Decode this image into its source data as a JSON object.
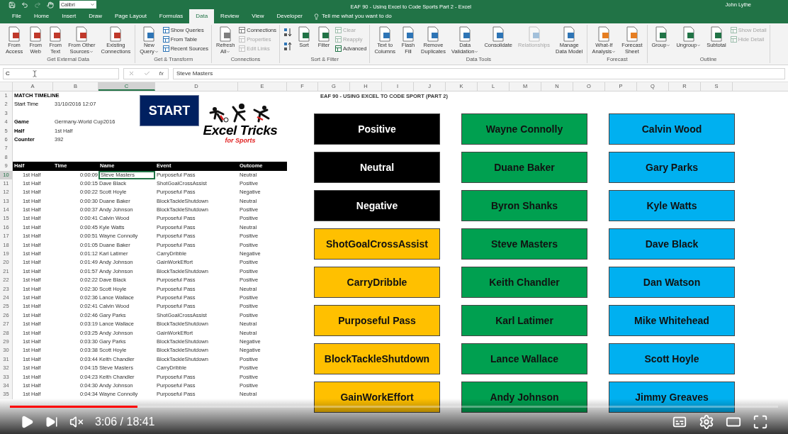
{
  "title_bar": {
    "font_box": "Calibri",
    "title": "EAF 90 - Using Excel to Code Sports Part 2 - Excel",
    "user": "John Lythe"
  },
  "tabs": [
    {
      "label": "File",
      "selected": false
    },
    {
      "label": "Home",
      "selected": false
    },
    {
      "label": "Insert",
      "selected": false
    },
    {
      "label": "Draw",
      "selected": false
    },
    {
      "label": "Page Layout",
      "selected": false
    },
    {
      "label": "Formulas",
      "selected": false
    },
    {
      "label": "Data",
      "selected": true
    },
    {
      "label": "Review",
      "selected": false
    },
    {
      "label": "View",
      "selected": false
    },
    {
      "label": "Developer",
      "selected": false
    }
  ],
  "tell_me": "Tell me what you want to do",
  "ribbon_groups": [
    {
      "label": "Get External Data",
      "items": [
        {
          "kind": "large",
          "lines": [
            "From",
            "Access"
          ],
          "dropdown": false,
          "disabled": false
        },
        {
          "kind": "large",
          "lines": [
            "From",
            "Web"
          ],
          "dropdown": false,
          "disabled": false
        },
        {
          "kind": "large",
          "lines": [
            "From",
            "Text"
          ],
          "dropdown": false,
          "disabled": false
        },
        {
          "kind": "large",
          "lines": [
            "From Other",
            "Sources"
          ],
          "dropdown": true,
          "disabled": false
        },
        {
          "kind": "large",
          "lines": [
            "Existing",
            "Connections"
          ],
          "dropdown": false,
          "disabled": false
        }
      ]
    },
    {
      "label": "Get & Transform",
      "items": [
        {
          "kind": "large",
          "lines": [
            "New",
            "Query"
          ],
          "dropdown": true,
          "disabled": false
        },
        {
          "kind": "small",
          "lines": [
            "Show Queries"
          ],
          "dropdown": false,
          "disabled": false
        },
        {
          "kind": "small",
          "lines": [
            "From Table"
          ],
          "dropdown": false,
          "disabled": false
        },
        {
          "kind": "small",
          "lines": [
            "Recent Sources"
          ],
          "dropdown": false,
          "disabled": false
        }
      ]
    },
    {
      "label": "Connections",
      "items": [
        {
          "kind": "large",
          "lines": [
            "Refresh",
            "All"
          ],
          "dropdown": true,
          "disabled": false
        },
        {
          "kind": "small",
          "lines": [
            "Connections"
          ],
          "dropdown": false,
          "disabled": false
        },
        {
          "kind": "small",
          "lines": [
            "Properties"
          ],
          "dropdown": false,
          "disabled": true
        },
        {
          "kind": "small",
          "lines": [
            "Edit Links"
          ],
          "dropdown": false,
          "disabled": true
        }
      ]
    },
    {
      "label": "Sort & Filter",
      "items": [
        {
          "kind": "sort_icons",
          "disabled": false
        },
        {
          "kind": "large",
          "lines": [
            "Sort"
          ],
          "dropdown": false,
          "disabled": false
        },
        {
          "kind": "large",
          "lines": [
            "Filter"
          ],
          "dropdown": false,
          "disabled": false
        },
        {
          "kind": "small",
          "lines": [
            "Clear"
          ],
          "dropdown": false,
          "disabled": true
        },
        {
          "kind": "small",
          "lines": [
            "Reapply"
          ],
          "dropdown": false,
          "disabled": true
        },
        {
          "kind": "small",
          "lines": [
            "Advanced"
          ],
          "dropdown": false,
          "disabled": false
        }
      ]
    },
    {
      "label": "Data Tools",
      "items": [
        {
          "kind": "large",
          "lines": [
            "Text to",
            "Columns"
          ],
          "dropdown": false,
          "disabled": false
        },
        {
          "kind": "large",
          "lines": [
            "Flash",
            "Fill"
          ],
          "dropdown": false,
          "disabled": false
        },
        {
          "kind": "large",
          "lines": [
            "Remove",
            "Duplicates"
          ],
          "dropdown": false,
          "disabled": false
        },
        {
          "kind": "large",
          "lines": [
            "Data",
            "Validation"
          ],
          "dropdown": true,
          "disabled": false
        },
        {
          "kind": "large",
          "lines": [
            "Consolidate"
          ],
          "dropdown": false,
          "disabled": false
        },
        {
          "kind": "large",
          "lines": [
            "Relationships"
          ],
          "dropdown": false,
          "disabled": true
        },
        {
          "kind": "large",
          "lines": [
            "Manage",
            "Data Model"
          ],
          "dropdown": false,
          "disabled": false
        }
      ]
    },
    {
      "label": "Forecast",
      "items": [
        {
          "kind": "large",
          "lines": [
            "What-If",
            "Analysis"
          ],
          "dropdown": true,
          "disabled": false
        },
        {
          "kind": "large",
          "lines": [
            "Forecast",
            "Sheet"
          ],
          "dropdown": false,
          "disabled": false
        }
      ]
    },
    {
      "label": "Outline",
      "items": [
        {
          "kind": "large",
          "lines": [
            "Group"
          ],
          "dropdown": true,
          "disabled": false
        },
        {
          "kind": "large",
          "lines": [
            "Ungroup"
          ],
          "dropdown": true,
          "disabled": false
        },
        {
          "kind": "large",
          "lines": [
            "Subtotal"
          ],
          "dropdown": false,
          "disabled": false
        },
        {
          "kind": "small",
          "lines": [
            "Show Detail"
          ],
          "dropdown": false,
          "disabled": true
        },
        {
          "kind": "small",
          "lines": [
            "Hide Detail"
          ],
          "dropdown": false,
          "disabled": true
        }
      ]
    }
  ],
  "formula_bar": {
    "name_box": "C",
    "function_label": "fx",
    "value": "Steve Masters"
  },
  "columns": [
    {
      "label": "A",
      "selected": false
    },
    {
      "label": "B",
      "selected": false
    },
    {
      "label": "C",
      "selected": true
    },
    {
      "label": "D",
      "selected": false
    },
    {
      "label": "E",
      "selected": false
    },
    {
      "label": "F",
      "selected": false
    },
    {
      "label": "G",
      "selected": false
    },
    {
      "label": "H",
      "selected": false
    },
    {
      "label": "I",
      "selected": false
    },
    {
      "label": "J",
      "selected": false
    },
    {
      "label": "K",
      "selected": false
    },
    {
      "label": "L",
      "selected": false
    },
    {
      "label": "M",
      "selected": false
    },
    {
      "label": "N",
      "selected": false
    },
    {
      "label": "O",
      "selected": false
    },
    {
      "label": "P",
      "selected": false
    },
    {
      "label": "Q",
      "selected": false
    },
    {
      "label": "R",
      "selected": false
    },
    {
      "label": "S",
      "selected": false
    }
  ],
  "info_rows": [
    {
      "number": "1",
      "label": "MATCH TIMELINE",
      "bold": true
    },
    {
      "number": "2",
      "label": "Start Time",
      "value": "31/10/2016 12:07",
      "bold": false
    },
    {
      "number": "3"
    },
    {
      "number": "4",
      "label": "Game",
      "value": "Germany-World Cup2016",
      "bold": true
    },
    {
      "number": "5",
      "label": "Half",
      "value": "1st Half",
      "bold": true
    },
    {
      "number": "6",
      "label": "Counter",
      "value": "392",
      "bold": true
    },
    {
      "number": "7"
    },
    {
      "number": "8"
    }
  ],
  "start_button": "START",
  "logo": {
    "title": "Excel Tricks",
    "subtitle": "for Sports"
  },
  "header_row": {
    "number": "9",
    "columns": [
      "Half",
      "Time",
      "Name",
      "Event",
      "Outcome"
    ]
  },
  "data_rows": [
    {
      "number": "10",
      "half": "1st Half",
      "time": "0:00:09",
      "name": "Steve Masters",
      "event": "Purposeful Pass",
      "outcome": "Neutral",
      "selected": true
    },
    {
      "number": "11",
      "half": "1st Half",
      "time": "0:00:15",
      "name": "Dave Black",
      "event": "ShotGoalCrossAssist",
      "outcome": "Positive",
      "selected": false
    },
    {
      "number": "12",
      "half": "1st Half",
      "time": "0:00:22",
      "name": "Scott Hoyle",
      "event": "Purposeful Pass",
      "outcome": "Negative",
      "selected": false
    },
    {
      "number": "13",
      "half": "1st Half",
      "time": "0:00:30",
      "name": "Duane Baker",
      "event": "BlockTackleShutdown",
      "outcome": "Neutral",
      "selected": false
    },
    {
      "number": "14",
      "half": "1st Half",
      "time": "0:00:37",
      "name": "Andy Johnson",
      "event": "BlockTackleShutdown",
      "outcome": "Positive",
      "selected": false
    },
    {
      "number": "15",
      "half": "1st Half",
      "time": "0:00:41",
      "name": "Calvin Wood",
      "event": "Purposeful Pass",
      "outcome": "Positive",
      "selected": false
    },
    {
      "number": "16",
      "half": "1st Half",
      "time": "0:00:45",
      "name": "Kyle Watts",
      "event": "Purposeful Pass",
      "outcome": "Neutral",
      "selected": false
    },
    {
      "number": "17",
      "half": "1st Half",
      "time": "0:00:51",
      "name": "Wayne Connolly",
      "event": "Purposeful Pass",
      "outcome": "Positive",
      "selected": false
    },
    {
      "number": "18",
      "half": "1st Half",
      "time": "0:01:05",
      "name": "Duane Baker",
      "event": "Purposeful Pass",
      "outcome": "Positive",
      "selected": false
    },
    {
      "number": "19",
      "half": "1st Half",
      "time": "0:01:12",
      "name": "Karl Latimer",
      "event": "CarryDribble",
      "outcome": "Negative",
      "selected": false
    },
    {
      "number": "20",
      "half": "1st Half",
      "time": "0:01:49",
      "name": "Andy Johnson",
      "event": "GainWorkEffort",
      "outcome": "Positive",
      "selected": false
    },
    {
      "number": "21",
      "half": "1st Half",
      "time": "0:01:57",
      "name": "Andy Johnson",
      "event": "BlockTackleShutdown",
      "outcome": "Positive",
      "selected": false
    },
    {
      "number": "22",
      "half": "1st Half",
      "time": "0:02:22",
      "name": "Dave Black",
      "event": "Purposeful Pass",
      "outcome": "Positive",
      "selected": false
    },
    {
      "number": "23",
      "half": "1st Half",
      "time": "0:02:30",
      "name": "Scott Hoyle",
      "event": "Purposeful Pass",
      "outcome": "Neutral",
      "selected": false
    },
    {
      "number": "24",
      "half": "1st Half",
      "time": "0:02:36",
      "name": "Lance Wallace",
      "event": "Purposeful Pass",
      "outcome": "Positive",
      "selected": false
    },
    {
      "number": "25",
      "half": "1st Half",
      "time": "0:02:41",
      "name": "Calvin Wood",
      "event": "Purposeful Pass",
      "outcome": "Positive",
      "selected": false
    },
    {
      "number": "26",
      "half": "1st Half",
      "time": "0:02:46",
      "name": "Gary Parks",
      "event": "ShotGoalCrossAssist",
      "outcome": "Positive",
      "selected": false
    },
    {
      "number": "27",
      "half": "1st Half",
      "time": "0:03:19",
      "name": "Lance Wallace",
      "event": "BlockTackleShutdown",
      "outcome": "Neutral",
      "selected": false
    },
    {
      "number": "28",
      "half": "1st Half",
      "time": "0:03:25",
      "name": "Andy Johnson",
      "event": "GainWorkEffort",
      "outcome": "Neutral",
      "selected": false
    },
    {
      "number": "29",
      "half": "1st Half",
      "time": "0:03:30",
      "name": "Gary Parks",
      "event": "BlockTackleShutdown",
      "outcome": "Negative",
      "selected": false
    },
    {
      "number": "30",
      "half": "1st Half",
      "time": "0:03:38",
      "name": "Scott Hoyle",
      "event": "BlockTackleShutdown",
      "outcome": "Negative",
      "selected": false
    },
    {
      "number": "31",
      "half": "1st Half",
      "time": "0:03:44",
      "name": "Keith Chandler",
      "event": "BlockTackleShutdown",
      "outcome": "Positive",
      "selected": false
    },
    {
      "number": "32",
      "half": "1st Half",
      "time": "0:04:15",
      "name": "Steve Masters",
      "event": "CarryDribble",
      "outcome": "Positive",
      "selected": false
    },
    {
      "number": "33",
      "half": "1st Half",
      "time": "0:04:23",
      "name": "Keith Chandler",
      "event": "Purposeful Pass",
      "outcome": "Positive",
      "selected": false
    },
    {
      "number": "34",
      "half": "1st Half",
      "time": "0:04:30",
      "name": "Andy Johnson",
      "event": "Purposeful Pass",
      "outcome": "Positive",
      "selected": false
    },
    {
      "number": "35",
      "half": "1st Half",
      "time": "0:04:34",
      "name": "Wayne Connolly",
      "event": "Purposeful Pass",
      "outcome": "Neutral",
      "selected": false
    }
  ],
  "sheet_title": "EAF 90 - USING EXCEL TO CODE SPORT (PART 2)",
  "shape_columns": [
    [
      {
        "label": "Positive",
        "color": "#000000"
      },
      {
        "label": "Neutral",
        "color": "#000000"
      },
      {
        "label": "Negative",
        "color": "#000000"
      },
      {
        "label": "ShotGoalCrossAssist",
        "color": "#ffc000"
      },
      {
        "label": "CarryDribble",
        "color": "#ffc000"
      },
      {
        "label": "Purposeful Pass",
        "color": "#ffc000"
      },
      {
        "label": "BlockTackleShutdown",
        "color": "#ffc000"
      },
      {
        "label": "GainWorkEffort",
        "color": "#ffc000"
      }
    ],
    [
      {
        "label": "Wayne Connolly",
        "color": "#00a050"
      },
      {
        "label": "Duane Baker",
        "color": "#00a050"
      },
      {
        "label": "Byron Shanks",
        "color": "#00a050"
      },
      {
        "label": "Steve Masters",
        "color": "#00a050"
      },
      {
        "label": "Keith Chandler",
        "color": "#00a050"
      },
      {
        "label": "Karl Latimer",
        "color": "#00a050"
      },
      {
        "label": "Lance Wallace",
        "color": "#00a050"
      },
      {
        "label": "Andy Johnson",
        "color": "#00a050"
      }
    ],
    [
      {
        "label": "Calvin Wood",
        "color": "#00b0f0"
      },
      {
        "label": "Gary Parks",
        "color": "#00b0f0"
      },
      {
        "label": "Kyle Watts",
        "color": "#00b0f0"
      },
      {
        "label": "Dave Black",
        "color": "#00b0f0"
      },
      {
        "label": "Dan Watson",
        "color": "#00b0f0"
      },
      {
        "label": "Mike Whitehead",
        "color": "#00b0f0"
      },
      {
        "label": "Scott Hoyle",
        "color": "#00b0f0"
      },
      {
        "label": "Jimmy Greaves",
        "color": "#00b0f0"
      }
    ]
  ],
  "player": {
    "level": 0.166,
    "time": "3:06 / 18:41",
    "muted": true
  }
}
